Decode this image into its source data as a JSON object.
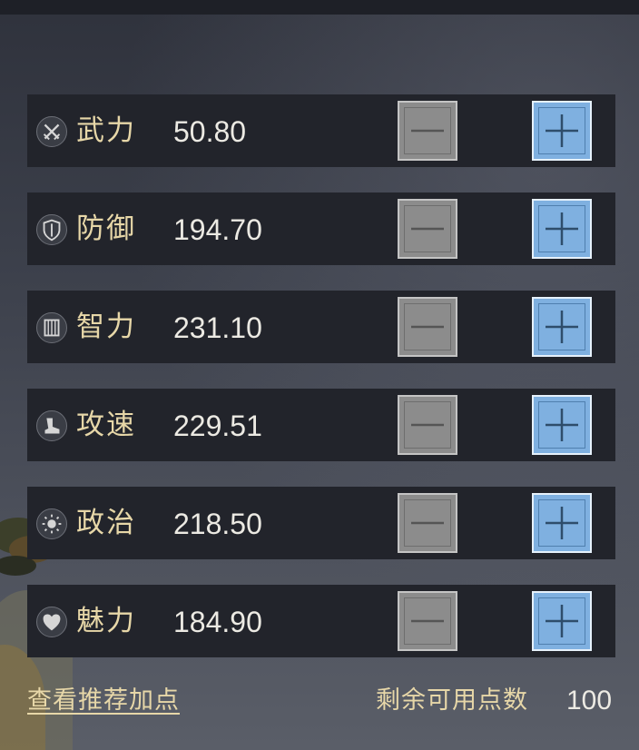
{
  "attributes": [
    {
      "label": "武力",
      "value": "50.80",
      "icon": "crossed-swords-icon"
    },
    {
      "label": "防御",
      "value": "194.70",
      "icon": "shield-icon"
    },
    {
      "label": "智力",
      "value": "231.10",
      "icon": "scroll-icon"
    },
    {
      "label": "攻速",
      "value": "229.51",
      "icon": "boot-icon"
    },
    {
      "label": "政治",
      "value": "218.50",
      "icon": "sun-icon"
    },
    {
      "label": "魅力",
      "value": "184.90",
      "icon": "heart-icon"
    }
  ],
  "footer": {
    "recommend_link": "查看推荐加点",
    "remaining_label": "剩余可用点数",
    "remaining_value": "100"
  },
  "colors": {
    "label_gold": "#e7d7a8",
    "plus_blue": "#7fb0e0",
    "minus_gray": "#8c8c8c",
    "row_bg": "#22242b"
  }
}
